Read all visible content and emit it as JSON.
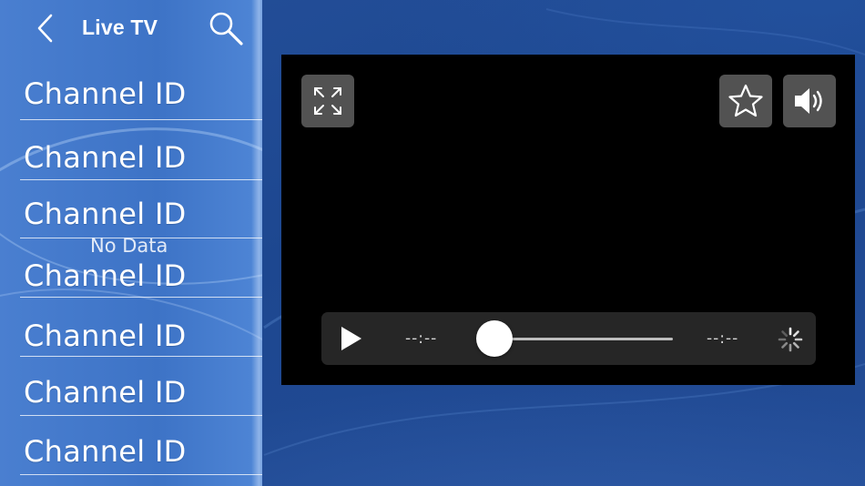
{
  "header": {
    "title": "Live TV"
  },
  "channels": [
    {
      "label": "Channel ID"
    },
    {
      "label": "Channel ID"
    },
    {
      "label": "Channel ID"
    },
    {
      "label": "Channel ID"
    },
    {
      "label": "Channel ID"
    },
    {
      "label": "Channel ID"
    },
    {
      "label": "Channel ID"
    }
  ],
  "channel_list": {
    "empty_text": "No Data"
  },
  "player": {
    "current_time": "--:--",
    "total_time": "--:--",
    "progress": 0,
    "buttons": {
      "fullscreen_icon": "expand-arrows-icon",
      "favorite_icon": "star-outline-icon",
      "volume_icon": "speaker-icon",
      "play_icon": "play-icon",
      "loading_icon": "spinner-icon"
    }
  },
  "colors": {
    "background": "#1f4a93",
    "sidebar": "#3d73c6",
    "player_background": "#000000",
    "controls_background": "#262626"
  }
}
